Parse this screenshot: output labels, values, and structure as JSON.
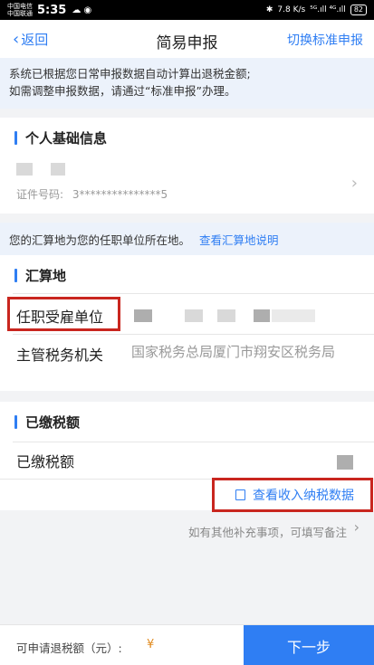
{
  "status_bar": {
    "carrier_1": "中国电信",
    "carrier_2": "中国联通",
    "time": "5:35",
    "left_icons": "☁ ◉",
    "network_speed": "7.8 K/s",
    "signal": "⁵ᴳ.ıll ⁴ᴳ.ıll",
    "battery": "82"
  },
  "nav": {
    "back_label": "返回",
    "title": "简易申报",
    "switch_label": "切换标准申报"
  },
  "notice": {
    "line1": "系统已根据您日常申报数据自动计算出退税金额;",
    "line2": "如需调整申报数据，请通过“标准申报”办理。"
  },
  "personal": {
    "section_title": "个人基础信息",
    "id_label": "证件号码:",
    "id_value": "3***************5"
  },
  "settlement_hint": {
    "text": "您的汇算地为您的任职单位所在地。",
    "link": "查看汇算地说明"
  },
  "settlement": {
    "section_title": "汇算地",
    "employer_label": "任职受雇单位",
    "tax_office_label": "主管税务机关",
    "tax_office_value": "国家税务总局厦门市翔安区税务局"
  },
  "paid_tax": {
    "section_title": "已缴税额",
    "row_label": "已缴税额",
    "view_income_label": "查看收入纳税数据"
  },
  "remark": {
    "text": "如有其他补充事项，可填写备注"
  },
  "footer": {
    "refund_label": "可申请退税额（元）:",
    "currency": "¥",
    "next_label": "下一步"
  },
  "colors": {
    "accent": "#2f7ef3",
    "highlight_box": "#c9261f",
    "notice_bg": "#ecf2fb"
  }
}
